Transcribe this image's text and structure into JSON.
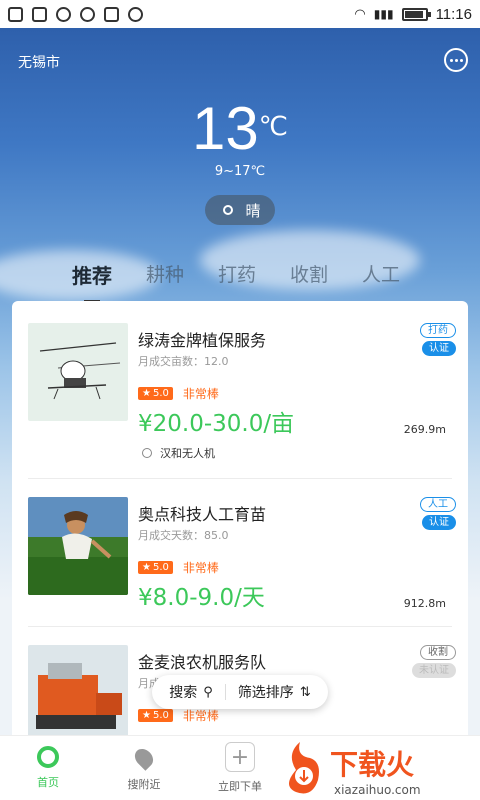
{
  "status_bar": {
    "time": "11:16"
  },
  "header": {
    "city": "无锡市"
  },
  "weather": {
    "temp": "13",
    "unit": "℃",
    "range": "9~17℃",
    "condition": "晴"
  },
  "tabs": [
    {
      "label": "推荐",
      "active": true
    },
    {
      "label": "耕种",
      "active": false
    },
    {
      "label": "打药",
      "active": false
    },
    {
      "label": "收割",
      "active": false
    },
    {
      "label": "人工",
      "active": false
    }
  ],
  "items": [
    {
      "title": "绿涛金牌植保服务",
      "stat": "月成交亩数：12.0",
      "rating": "5.0",
      "rating_text": "非常棒",
      "price": "¥20.0-30.0/亩",
      "distance": "269.9m",
      "tag": "打药",
      "verified": "认证",
      "brand": "汉和无人机"
    },
    {
      "title": "奥点科技人工育苗",
      "stat": "月成交天数：85.0",
      "rating": "5.0",
      "rating_text": "非常棒",
      "price": "¥8.0-9.0/天",
      "distance": "912.8m",
      "tag": "人工",
      "verified": "认证"
    },
    {
      "title": "金麦浪农机服务队",
      "stat": "月成",
      "rating": "5.0",
      "rating_text": "非常棒",
      "tag": "收割",
      "verified": "未认证"
    }
  ],
  "float_bar": {
    "search": "搜索",
    "sort": "筛选排序"
  },
  "bottom_nav": [
    {
      "label": "首页"
    },
    {
      "label": "搜附近"
    },
    {
      "label": "立即下单"
    }
  ],
  "watermark": {
    "text": "下载火",
    "url": "xiazaihuo.com"
  },
  "colors": {
    "accent_green": "#3cc85a",
    "tag_blue": "#1a8fe8",
    "rating_orange": "#ff6a1a"
  }
}
